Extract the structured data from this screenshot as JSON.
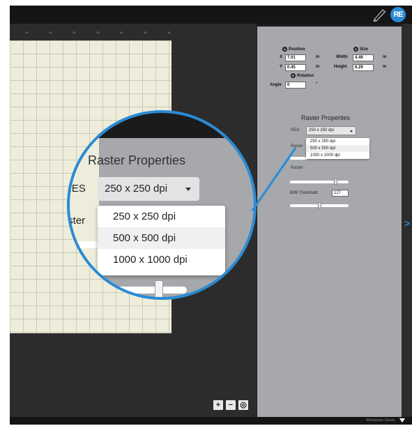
{
  "app": {
    "logo_text": "RE"
  },
  "ruler": {
    "ticks": [
      "10",
      "11",
      "12",
      "13",
      "14",
      "15",
      "16"
    ]
  },
  "zoom": {
    "plus": "+",
    "minus": "−",
    "fit": "◎"
  },
  "transform": {
    "position_header": "Position",
    "position_badge": "A",
    "size_header": "Size",
    "size_badge": "S",
    "rotation_header": "Rotation",
    "rotation_badge": "R",
    "x_label": "X",
    "x_value": "7.01",
    "y_label": "Y",
    "y_value": "0.45",
    "width_label": "Width",
    "width_value": "4.49",
    "height_label": "Height",
    "height_value": "6.29",
    "angle_label": "Angle",
    "angle_value": "0",
    "unit": "in",
    "degree": "°"
  },
  "raster": {
    "title": "Raster Properties",
    "res_label": "RES",
    "res_selected": "250 x 250 dpi",
    "res_options": [
      "250 x 250 dpi",
      "500 x 500 dpi",
      "1000 x 1000 dpi"
    ],
    "raster_label_1": "Raster",
    "raster_label_2": "Raster",
    "bw_label": "B/W Threshold",
    "bw_value": "127",
    "mag_bw_fragment": "hold",
    "slider_levels": {
      "slider_1": 0.5,
      "slider_2": 0.78,
      "slider_3": 0.5
    }
  },
  "footer": {
    "status": "Workspace Saved."
  },
  "colors": {
    "accent": "#2a8bd4",
    "panel": "#a6a8ab",
    "paper": "#eeeddc",
    "dark": "#1b1b1b"
  }
}
